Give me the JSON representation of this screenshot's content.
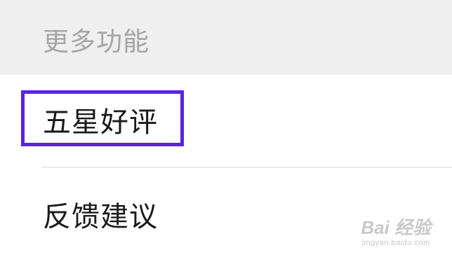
{
  "section": {
    "title": "更多功能"
  },
  "items": [
    {
      "label": "五星好评"
    },
    {
      "label": "反馈建议"
    }
  ],
  "highlight": {
    "color": "#5b21e6"
  },
  "watermark": {
    "main": "Bai 经验",
    "sub": "jingyan.baidu.com"
  }
}
